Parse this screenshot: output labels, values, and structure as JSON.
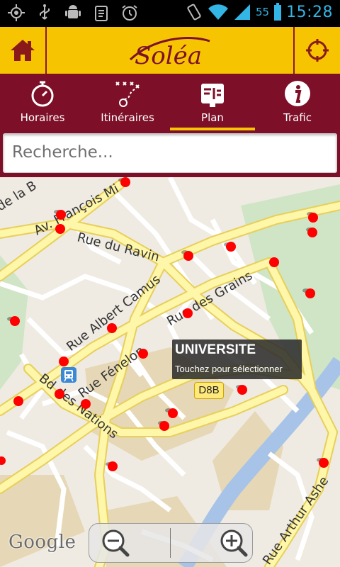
{
  "status_bar": {
    "time": "15:28",
    "battery_percent": "55",
    "icons": [
      "gps-icon",
      "usb-icon",
      "android-debug-icon",
      "clipboard-icon",
      "alarm-icon",
      "vibrate-icon",
      "wifi-icon",
      "signal-icon",
      "battery-icon"
    ]
  },
  "app_bar": {
    "logo_text": "Soléa",
    "home_icon": "home-icon",
    "locate_icon": "crosshair-icon",
    "accent": "#f6c400",
    "brand_dark": "#7d1028"
  },
  "tabs": [
    {
      "label": "Horaires",
      "icon": "stopwatch-icon",
      "active": false
    },
    {
      "label": "Itinéraires",
      "icon": "route-icon",
      "active": false
    },
    {
      "label": "Plan",
      "icon": "map-board-icon",
      "active": true
    },
    {
      "label": "Trafic",
      "icon": "info-icon",
      "active": false
    }
  ],
  "search": {
    "placeholder": "Recherche..."
  },
  "map": {
    "streets": [
      "de la B",
      "Av. François Mi",
      "Rue du Ravin",
      "Rue Albert Camus",
      "Rue des Grains",
      "Rue Fénelon",
      "Bd des Nations",
      "Rue Arthur Ashe"
    ],
    "tooltip": {
      "title": "UNIVERSITE",
      "subtitle": "Touchez pour sélectionner"
    },
    "road_badge": "D8B",
    "attribution": "Google",
    "zoom_out_icon": "zoom-out-icon",
    "zoom_in_icon": "zoom-in-icon",
    "stop_color": "#ff0000"
  }
}
